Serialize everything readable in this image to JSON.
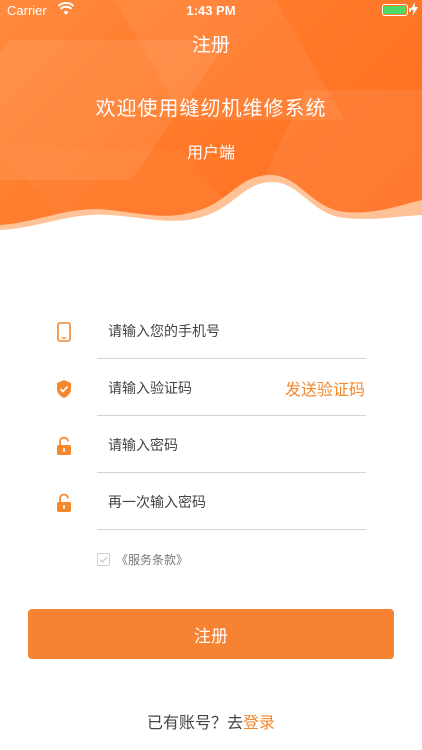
{
  "status_bar": {
    "carrier": "Carrier",
    "time": "1:43 PM",
    "battery_color": "#4cd964"
  },
  "header": {
    "title": "注册",
    "welcome": "欢迎使用缝纫机维修系统",
    "subtitle": "用户端"
  },
  "form": {
    "phone": {
      "placeholder": "请输入您的手机号",
      "value": "",
      "icon": "phone-icon"
    },
    "code": {
      "placeholder": "请输入验证码",
      "value": "",
      "icon": "shield-check-icon",
      "send_label": "发送验证码"
    },
    "password": {
      "placeholder": "请输入密码",
      "value": "",
      "icon": "unlock-icon"
    },
    "confirm": {
      "placeholder": "再一次输入密码",
      "value": "",
      "icon": "unlock-icon"
    }
  },
  "terms": {
    "label": "《服务条款》",
    "checked": true
  },
  "register_button": "注册",
  "footer": {
    "prompt": "已有账号？去",
    "login_label": "登录"
  },
  "colors": {
    "accent": "#f5872d",
    "button": "#f78232",
    "header_gradient": [
      "#ff8a3d",
      "#ff6d1f"
    ]
  }
}
